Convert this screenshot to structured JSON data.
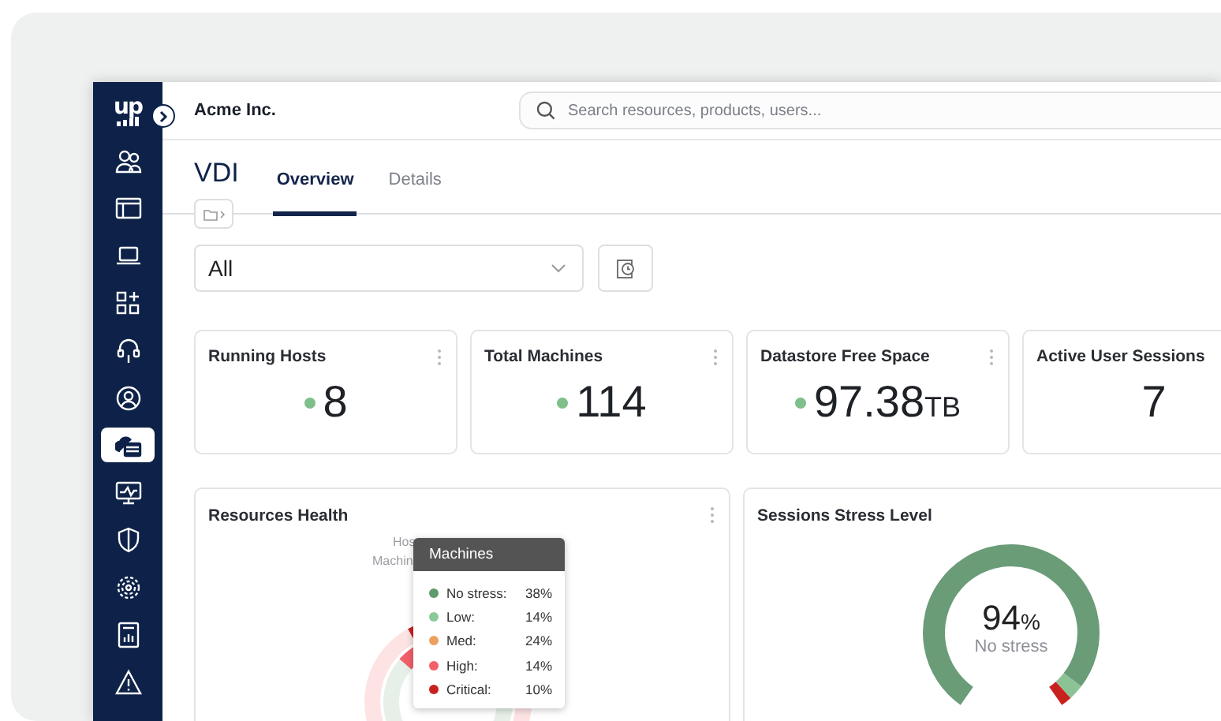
{
  "sidebar": {
    "logo": "up",
    "items": [
      {
        "selected": false
      },
      {
        "selected": false
      },
      {
        "selected": false
      },
      {
        "selected": false
      },
      {
        "selected": false
      },
      {
        "selected": false
      },
      {
        "selected": true
      },
      {
        "selected": false
      },
      {
        "selected": false
      },
      {
        "selected": false
      },
      {
        "selected": false
      },
      {
        "selected": false
      }
    ]
  },
  "header": {
    "company": "Acme Inc.",
    "search": {
      "placeholder": "Search resources, products, users..."
    }
  },
  "page": {
    "title": "VDI",
    "tabs": [
      {
        "label": "Overview",
        "selected": true
      },
      {
        "label": "Details",
        "selected": false
      }
    ]
  },
  "filter": {
    "value": "All"
  },
  "stats": [
    {
      "title": "Running Hosts",
      "value": "8",
      "color": "#7fbf8b",
      "menu": true
    },
    {
      "title": "Total Machines",
      "value": "114",
      "color": "#7fbf8b",
      "menu": true
    },
    {
      "title": "Datastore Free Space",
      "value": "97.38",
      "unit": "TB",
      "color": "#7fbf8b",
      "menu": true
    },
    {
      "title": "Active User Sessions",
      "value": "7",
      "menu": false
    }
  ],
  "resources_health": {
    "title": "Resources Health",
    "ring_labels": [
      "Hos",
      "Machin"
    ],
    "tooltip": {
      "title": "Machines",
      "rows": [
        {
          "label": "No stress:",
          "value": "38%",
          "color": "#5f9a6e"
        },
        {
          "label": "Low:",
          "value": "14%",
          "color": "#8cc99a"
        },
        {
          "label": "Med:",
          "value": "24%",
          "color": "#eba05c"
        },
        {
          "label": "High:",
          "value": "14%",
          "color": "#f2606a"
        },
        {
          "label": "Critical:",
          "value": "10%",
          "color": "#c8221f"
        }
      ]
    }
  },
  "sessions_stress": {
    "title": "Sessions Stress Level",
    "value": "94",
    "unit": "%",
    "caption": "No stress"
  }
}
